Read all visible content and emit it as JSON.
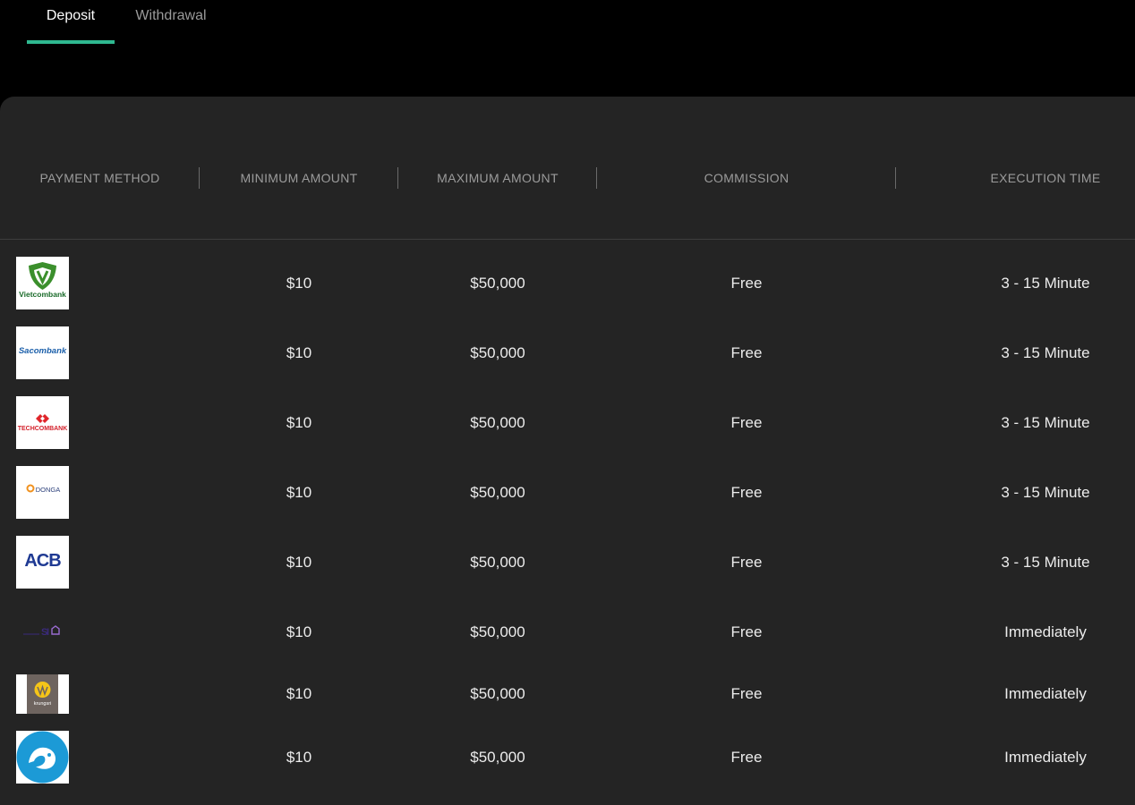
{
  "tabs": {
    "deposit": "Deposit",
    "withdrawal": "Withdrawal"
  },
  "table": {
    "headers": {
      "payment_method": "PAYMENT METHOD",
      "min": "MINIMUM AMOUNT",
      "max": "MAXIMUM AMOUNT",
      "commission": "COMMISSION",
      "time": "EXECUTION TIME"
    },
    "rows": [
      {
        "logo": "Vietcombank",
        "min": "$10",
        "max": "$50,000",
        "commission": "Free",
        "time": "3 - 15 Minute"
      },
      {
        "logo": "Sacombank",
        "min": "$10",
        "max": "$50,000",
        "commission": "Free",
        "time": "3 - 15 Minute"
      },
      {
        "logo": "TECHCOMBANK",
        "min": "$10",
        "max": "$50,000",
        "commission": "Free",
        "time": "3 - 15 Minute"
      },
      {
        "logo": "DONGA",
        "min": "$10",
        "max": "$50,000",
        "commission": "Free",
        "time": "3 - 15 Minute"
      },
      {
        "logo": "ACB",
        "min": "$10",
        "max": "$50,000",
        "commission": "Free",
        "time": "3 - 15 Minute"
      },
      {
        "logo": "SCB",
        "min": "$10",
        "max": "$50,000",
        "commission": "Free",
        "time": "Immediately"
      },
      {
        "logo": "krungsri",
        "min": "$10",
        "max": "$50,000",
        "commission": "Free",
        "time": "Immediately"
      },
      {
        "logo": "KBank",
        "min": "$10",
        "max": "$50,000",
        "commission": "Free",
        "time": "Immediately"
      }
    ]
  },
  "colors": {
    "accent": "#2fb990",
    "panel": "#242424",
    "background": "#000000"
  }
}
